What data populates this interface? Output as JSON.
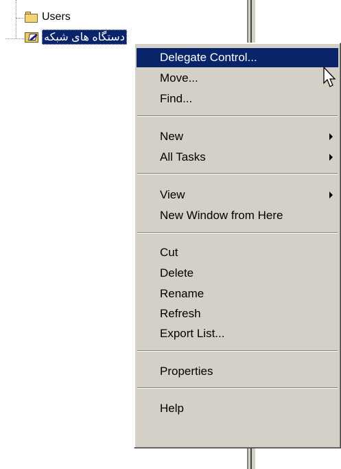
{
  "tree": {
    "nodes": [
      {
        "label": "Users"
      },
      {
        "label": "دستگاه های شبکه"
      }
    ]
  },
  "context_menu": {
    "items": [
      {
        "label": "Delegate Control...",
        "selected": true
      },
      {
        "label": "Move..."
      },
      {
        "label": "Find..."
      },
      {
        "label": "New",
        "submenu": true
      },
      {
        "label": "All Tasks",
        "submenu": true
      },
      {
        "label": "View",
        "submenu": true
      },
      {
        "label": "New Window from Here"
      },
      {
        "label": "Cut"
      },
      {
        "label": "Delete"
      },
      {
        "label": "Rename"
      },
      {
        "label": "Refresh"
      },
      {
        "label": "Export List..."
      },
      {
        "label": "Properties"
      },
      {
        "label": "Help"
      }
    ]
  },
  "colors": {
    "menu_bg": "#d4d0c8",
    "selection": "#0a246a",
    "folder": "#f1d478"
  },
  "icons": [
    "folder-icon",
    "organizational-unit-icon",
    "submenu-arrow-icon",
    "mouse-cursor-icon"
  ]
}
